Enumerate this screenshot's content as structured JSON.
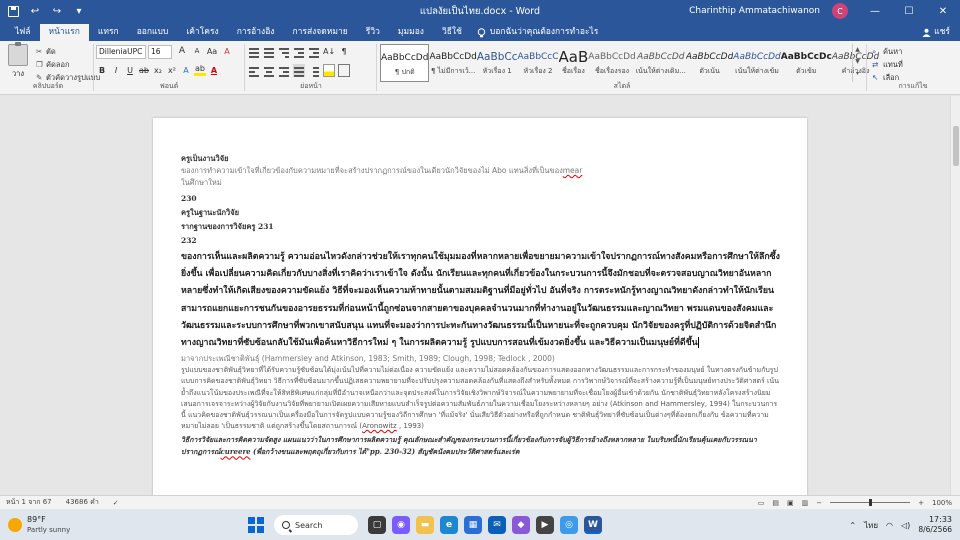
{
  "window": {
    "title": "แปลงัยเป็นไทย.docx  -  Word",
    "user": "Charinthip Ammatachiwanon",
    "avatar_initials": "C",
    "min": "—",
    "max": "☐",
    "close": "✕",
    "autosave": "↩",
    "redo": "↪",
    "customize": "▾"
  },
  "tabs": [
    "ไฟล์",
    "หน้าแรก",
    "แทรก",
    "ออกแบบ",
    "เค้าโครง",
    "การอ้างอิง",
    "การส่งจดหมาย",
    "รีวิว",
    "มุมมอง",
    "วิธีใช้"
  ],
  "tell_me": "บอกฉันว่าคุณต้องการทำอะไร",
  "share": "แชร์",
  "clipboard": {
    "paste": "วาง",
    "cut": "ตัด",
    "copy": "คัดลอก",
    "format_painter": "ตัวคัดวางรูปแบบ",
    "group": "คลิปบอร์ด"
  },
  "font": {
    "name": "DilleniaUPC",
    "size": "16",
    "group": "ฟอนต์",
    "buttons_top": [
      "A",
      "A",
      "Aa",
      "A"
    ],
    "buttons_bottom": [
      "B",
      "I",
      "U",
      "ab",
      "x₂",
      "x²",
      "A",
      "ab",
      "A"
    ]
  },
  "paragraph": {
    "group": "ย่อหน้า",
    "sort": "A↓",
    "mark": "¶"
  },
  "styles": {
    "group": "สไตล์",
    "items": [
      {
        "preview": "AaBbCcDd",
        "name": "¶ ปกติ"
      },
      {
        "preview": "AaBbCcDd",
        "name": "¶ ไม่มีการเว้..."
      },
      {
        "preview": "AaBbCc",
        "name": "หัวเรื่อง 1"
      },
      {
        "preview": "AaBbCcC",
        "name": "หัวเรื่อง 2"
      },
      {
        "preview": "AaB",
        "name": "ชื่อเรื่อง"
      },
      {
        "preview": "AaBbCcDd",
        "name": "ชื่อเรื่องรอง"
      },
      {
        "preview": "AaBbCcDd",
        "name": "เน้นให้ต่างเดิม..."
      },
      {
        "preview": "AaBbCcDd",
        "name": "ตัวเน้น"
      },
      {
        "preview": "AaBbCcDd",
        "name": "เน้นให้ต่างเข้ม"
      },
      {
        "preview": "AaBbCcDc",
        "name": "ตัวเข้ม"
      },
      {
        "preview": "AaBbCcDd",
        "name": "คำอ้างอิง"
      }
    ]
  },
  "editing": {
    "find": "ค้นหา",
    "replace": "แทนที่",
    "select": "เลือก",
    "group": "การแก้ไข"
  },
  "document": {
    "heading1": "ครูเป็นงานวิจัย",
    "faint1": "ของการทำความเข้าใจที่เกี่ยวข้องกับความหมายที่จะสร้างปรากฏการณ์ของในเดียวนักวิจัยของไม่ Abo แทนสิ่งที่เป็นของ",
    "faint1_err": "mear",
    "faint2": "ในศึกษาใหม่",
    "num1": "230",
    "heading2": "ครูในฐานะนักวิจัย",
    "heading3": "รากฐานของการวิจัยครู 231",
    "num2": "232",
    "big_para": "ของการเห็นและผลิตความรู้ ความอ่อนไหวดังกล่าวช่วยให้เราทุกคนใช้มุมมองที่หลากหลายเพื่อขยายมาความเข้าใจปรากฏการณ์ทางสังคมหรือการศึกษาให้ลึกซึ้งยิ่งขึ้น เพื่อเปลี่ยนความคิดเกี่ยวกับบางสิ่งที่เราคิดว่าเราเข้าใจ ดังนั้น นักเรียนและทุกคนที่เกี่ยวข้องในกระบวนการนี้จึงมักชอบที่จะตรวจสอบญาณวิทยาอันหลากหลายซึ่งทำให้เกิดเสียงของความขัดแย้ง วิธีที่จะมองเห็นความท้าทายนั้นตามสมมติฐานที่มีอยู่ทั่วไป อันที่จริง การตระหนักรู้ทางญาณวิทยาดังกล่าวทำให้นักเรียนสามารถแยกแยะการชนกันของอารยธรรมที่ก่อนหน้านี้ถูกซ่อนจากสายตาของบุคคลจำนวนมากที่ทำงานอยู่ในวัฒนธรรมและญาณวิทยา พรมแดนของสังคมและวัฒนธรรมและระบบการศึกษาที่พวกเขาสนับสนุน แทนที่จะมองว่าการปะทะกันทางวัฒนธรรมนี้เป็นหายนะที่จะถูกควบคุม นักวิจัยของครูที่ปฏิบัติการด้วยจิตสำนึกทางญาณวิทยาที่ซับซ้อนกลับใช้มันเพื่อค้นหาวิธีการใหม่ ๆ ในการผลิตความรู้ รูปแบบการสอนที่เข้มงวดยิ่งขึ้น และวิธีความเป็นมนุษย์ที่ดีขึ้น",
    "cite1": "มาจากประเพณีชาติพันธุ์ (Hammersley and Atkinson, 1983; Smith, 1989; Clough, 1998; Tedlock , 2000)",
    "small_para": "รูปแบบของชาติพันธุ์วิทยาที่ได้รับความรู้ซับซ้อนได้มุ่งเน้นไปที่ความไม่ต่อเนื่อง ความขัดแย้ง และความไม่สอดคล้องกันของการแสดงออกทางวัฒนธรรมและการกระทำของมนุษย์ ในทางตรงกันข้ามกับรูปแบบการคิดของชาติพันธุ์วิทยา วิธีการที่ซับซ้อนมากขึ้นปฏิเสธความพยายามที่จะปรับปรุงความสอดคล้องกันที่แสดงถึงสำหรับทั้งหมด การวิพากษ์วิจารณ์ที่จะสร้างความรู้ที่เป็นมนุษย์ทางประวัติศาสตร์ เน้นย้ำถึงแนวโน้มของประเพณีที่จะให้สิทธิพิเศษแก่กลุ่มที่มีอำนาจเหนือกว่าและจุดประสงค์ในการวิจัยเชิงวิพากษ์วิจารณ์ในความพยายามที่จะเชื่อมโยงผู้อื่นเข้าด้วยกัน นักชาติพันธุ์วิทยาหลังโครงสร้างนิยมเสนอการเจรจาระหว่างผู้วิจัยกับงานวิจัยที่พยายามเปิดเผยความเสียหายแบบสำเร็จรูปต่อความสัมพันธ์ภายในความเชื่อมโยงระหว่างหลายๆ อย่าง (Atkinson and Hammersley, 1994) ในกระบวนการนี้ แนวคิดของชาติพันธุ์วรรณนาเป็นเครื่องมือในการจัดรูปแบบความรู้ของวิถีการศึกษา 'ที่แม้จริง' นั่นเสียวิธีตัวอย่างหรือที่ถูกกำหนด ชาติพันธุ์วิทยาที่ซับซ้อนเป็นต่างๆที่ต้องยกเกี่ยงกับ ข้อความที่ความหมายไม่ลอย 'เป็นธรรมชาติ แต่ถูกสร้างขึ้นโดยสถานการณ์ (",
    "small_err": "Aronowitz",
    "small_end": " , 1993)",
    "ital1": "วิธีการวิจัยและการคิดความจัดสูง แผนแนวว่าในการศึกษาการผลิตความรู้ คุณลักษณะสำคัญของกระบวนการนี้เกี่ยวข้องกับการจับผู้วิธีการอ้างถึงหลากหลาย ในบริบทนี้นักเรียนคุ้นเคยกับวรรณนาปรากฏการณ์",
    "ital1_err": "cureere",
    "ital1_end": " (พื่อกว้างขนและพฤตถุเกี่ยวกับการ ได้\"pp. 230-32) สัญชัคนังคมประวัติศาสตร์และเร่ค"
  },
  "status": {
    "page": "หน้า 1 จาก 67",
    "words": "43686 คำ",
    "lang_icon": "✓",
    "zoom": "100%",
    "zoom_fraction": 0.5
  },
  "taskbar": {
    "temp": "89°F",
    "cond": "Partly sunny",
    "search": "Search",
    "time": "17:33",
    "date": "8/6/2566",
    "lang": "ไทย",
    "up_arrow": "⌃"
  }
}
